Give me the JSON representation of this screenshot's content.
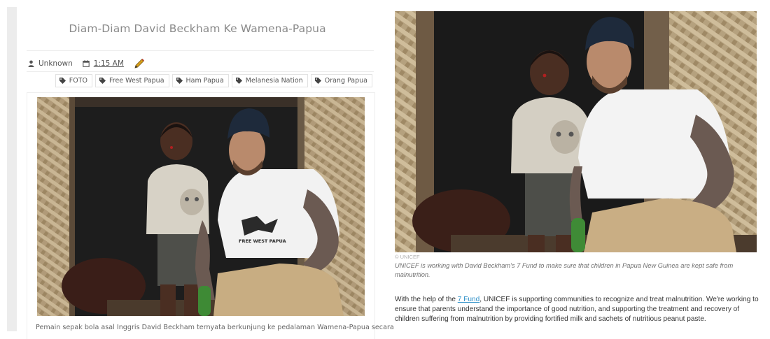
{
  "post": {
    "title": "Diam-Diam David Beckham Ke Wamena-Papua",
    "author": "Unknown",
    "time": "1:15 AM",
    "tags": [
      "FOTO",
      "Free West Papua",
      "Ham Papua",
      "Melanesia Nation",
      "Orang Papua"
    ],
    "excerpt": "Pemain sepak bola asal Inggris David Beckham  ternyata berkunjung ke pedalaman Wamena-Papua secara",
    "shirt_print": "FREE WEST PAPUA"
  },
  "unicef": {
    "credit": "© UNICEF",
    "caption": "UNICEF is working with David Beckham's 7 Fund to make sure that children in Papua New Guinea are kept safe from malnutrition.",
    "body_before": "With the help of the ",
    "link_text": "7 Fund",
    "body_after": ", UNICEF is supporting communities to recognize and treat malnutrition. We're working to ensure that parents understand the importance of good nutrition, and supporting the treatment and recovery of children suffering from malnutrition by providing fortified milk and sachets of nutritious peanut paste."
  },
  "colors": {
    "link": "#2c8fc7",
    "pencil": "#d9a01a"
  },
  "icons": [
    "user-icon",
    "calendar-icon",
    "pencil-icon",
    "tag-icon"
  ]
}
